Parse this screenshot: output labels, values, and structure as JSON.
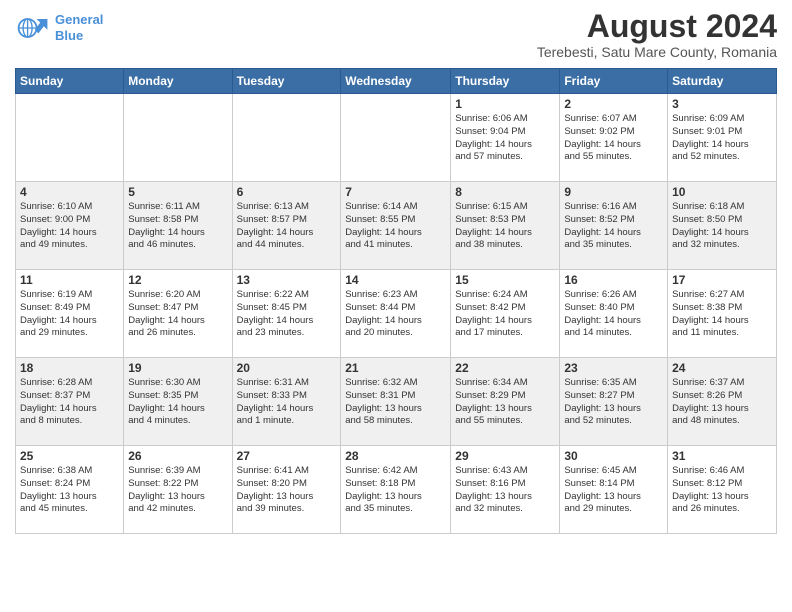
{
  "logo": {
    "line1": "General",
    "line2": "Blue"
  },
  "title": "August 2024",
  "location": "Terebesti, Satu Mare County, Romania",
  "weekdays": [
    "Sunday",
    "Monday",
    "Tuesday",
    "Wednesday",
    "Thursday",
    "Friday",
    "Saturday"
  ],
  "weeks": [
    [
      {
        "day": "",
        "info": ""
      },
      {
        "day": "",
        "info": ""
      },
      {
        "day": "",
        "info": ""
      },
      {
        "day": "",
        "info": ""
      },
      {
        "day": "1",
        "info": "Sunrise: 6:06 AM\nSunset: 9:04 PM\nDaylight: 14 hours\nand 57 minutes."
      },
      {
        "day": "2",
        "info": "Sunrise: 6:07 AM\nSunset: 9:02 PM\nDaylight: 14 hours\nand 55 minutes."
      },
      {
        "day": "3",
        "info": "Sunrise: 6:09 AM\nSunset: 9:01 PM\nDaylight: 14 hours\nand 52 minutes."
      }
    ],
    [
      {
        "day": "4",
        "info": "Sunrise: 6:10 AM\nSunset: 9:00 PM\nDaylight: 14 hours\nand 49 minutes."
      },
      {
        "day": "5",
        "info": "Sunrise: 6:11 AM\nSunset: 8:58 PM\nDaylight: 14 hours\nand 46 minutes."
      },
      {
        "day": "6",
        "info": "Sunrise: 6:13 AM\nSunset: 8:57 PM\nDaylight: 14 hours\nand 44 minutes."
      },
      {
        "day": "7",
        "info": "Sunrise: 6:14 AM\nSunset: 8:55 PM\nDaylight: 14 hours\nand 41 minutes."
      },
      {
        "day": "8",
        "info": "Sunrise: 6:15 AM\nSunset: 8:53 PM\nDaylight: 14 hours\nand 38 minutes."
      },
      {
        "day": "9",
        "info": "Sunrise: 6:16 AM\nSunset: 8:52 PM\nDaylight: 14 hours\nand 35 minutes."
      },
      {
        "day": "10",
        "info": "Sunrise: 6:18 AM\nSunset: 8:50 PM\nDaylight: 14 hours\nand 32 minutes."
      }
    ],
    [
      {
        "day": "11",
        "info": "Sunrise: 6:19 AM\nSunset: 8:49 PM\nDaylight: 14 hours\nand 29 minutes."
      },
      {
        "day": "12",
        "info": "Sunrise: 6:20 AM\nSunset: 8:47 PM\nDaylight: 14 hours\nand 26 minutes."
      },
      {
        "day": "13",
        "info": "Sunrise: 6:22 AM\nSunset: 8:45 PM\nDaylight: 14 hours\nand 23 minutes."
      },
      {
        "day": "14",
        "info": "Sunrise: 6:23 AM\nSunset: 8:44 PM\nDaylight: 14 hours\nand 20 minutes."
      },
      {
        "day": "15",
        "info": "Sunrise: 6:24 AM\nSunset: 8:42 PM\nDaylight: 14 hours\nand 17 minutes."
      },
      {
        "day": "16",
        "info": "Sunrise: 6:26 AM\nSunset: 8:40 PM\nDaylight: 14 hours\nand 14 minutes."
      },
      {
        "day": "17",
        "info": "Sunrise: 6:27 AM\nSunset: 8:38 PM\nDaylight: 14 hours\nand 11 minutes."
      }
    ],
    [
      {
        "day": "18",
        "info": "Sunrise: 6:28 AM\nSunset: 8:37 PM\nDaylight: 14 hours\nand 8 minutes."
      },
      {
        "day": "19",
        "info": "Sunrise: 6:30 AM\nSunset: 8:35 PM\nDaylight: 14 hours\nand 4 minutes."
      },
      {
        "day": "20",
        "info": "Sunrise: 6:31 AM\nSunset: 8:33 PM\nDaylight: 14 hours\nand 1 minute."
      },
      {
        "day": "21",
        "info": "Sunrise: 6:32 AM\nSunset: 8:31 PM\nDaylight: 13 hours\nand 58 minutes."
      },
      {
        "day": "22",
        "info": "Sunrise: 6:34 AM\nSunset: 8:29 PM\nDaylight: 13 hours\nand 55 minutes."
      },
      {
        "day": "23",
        "info": "Sunrise: 6:35 AM\nSunset: 8:27 PM\nDaylight: 13 hours\nand 52 minutes."
      },
      {
        "day": "24",
        "info": "Sunrise: 6:37 AM\nSunset: 8:26 PM\nDaylight: 13 hours\nand 48 minutes."
      }
    ],
    [
      {
        "day": "25",
        "info": "Sunrise: 6:38 AM\nSunset: 8:24 PM\nDaylight: 13 hours\nand 45 minutes."
      },
      {
        "day": "26",
        "info": "Sunrise: 6:39 AM\nSunset: 8:22 PM\nDaylight: 13 hours\nand 42 minutes."
      },
      {
        "day": "27",
        "info": "Sunrise: 6:41 AM\nSunset: 8:20 PM\nDaylight: 13 hours\nand 39 minutes."
      },
      {
        "day": "28",
        "info": "Sunrise: 6:42 AM\nSunset: 8:18 PM\nDaylight: 13 hours\nand 35 minutes."
      },
      {
        "day": "29",
        "info": "Sunrise: 6:43 AM\nSunset: 8:16 PM\nDaylight: 13 hours\nand 32 minutes."
      },
      {
        "day": "30",
        "info": "Sunrise: 6:45 AM\nSunset: 8:14 PM\nDaylight: 13 hours\nand 29 minutes."
      },
      {
        "day": "31",
        "info": "Sunrise: 6:46 AM\nSunset: 8:12 PM\nDaylight: 13 hours\nand 26 minutes."
      }
    ]
  ]
}
